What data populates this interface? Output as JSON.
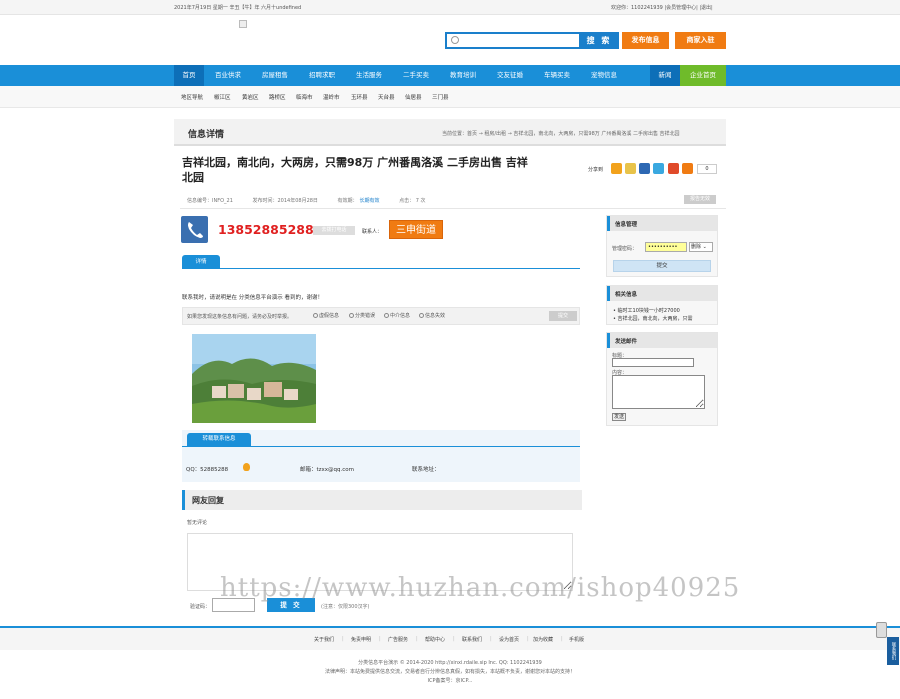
{
  "colors": {
    "accent": "#1a8fd8",
    "orange": "#f07b12",
    "phone_red": "#e02020",
    "enterprise_green": "#6fbb2a"
  },
  "topbar": {
    "date": "2021年7月19日 星期一 辛丑【牛】年 六月十undefined",
    "welcome": "欢迎你：1102241939 |会员管理中心| |退出|"
  },
  "header": {
    "search_placeholder": "",
    "search_button": "搜 索",
    "post_button": "发布信息",
    "merchant_button": "商家入驻"
  },
  "nav": {
    "items": [
      "首页",
      "百业供求",
      "房屋租售",
      "招聘求职",
      "生活服务",
      "二手买卖",
      "教育培训",
      "交友征婚",
      "车辆买卖",
      "宠物信息",
      "新闻",
      "企业首页"
    ]
  },
  "subnav": {
    "areas": [
      "地区导航",
      "椒江区",
      "黄岩区",
      "路桥区",
      "临海市",
      "温岭市",
      "玉环县",
      "天台县",
      "仙居县",
      "三门县"
    ]
  },
  "breadcrumb": {
    "title": "信息详情",
    "path": "当前位置：首页 → 租房/出租 → 吉祥北园，南北向，大两房，只需98万 广州番禺洛溪 二手房出售 吉祥北园"
  },
  "listing": {
    "title": "吉祥北园，南北向，大两房，只需98万 广州番禺洛溪 二手房出售 吉祥北园",
    "share_label": "分享到",
    "share_count": "0",
    "meta": {
      "id": "信息编号：INFO_21",
      "date": "发布时间：2014年08月28日",
      "validity": "有效期：",
      "validity_value": "长期有效",
      "hits": "点击： 7 次"
    },
    "report_button": "报告无效",
    "phone": "13852885288",
    "dial_button": "去拨打电话",
    "contact_label": "联系人：",
    "contact_name": "三申街道",
    "tab_label": "详情",
    "description": "联系我时，请说明是在 分类信息平台演示 看到的，谢谢！",
    "report_text": "如果您发现这条信息有问题，请务必及时举报。",
    "report_options": [
      "虚假信息",
      "分类错误",
      "中介信息",
      "信息失效"
    ],
    "report_submit": "提交"
  },
  "merchant": {
    "tab_label": "转载联系信息",
    "qq": "QQ：52885288",
    "email": "邮箱：tzxx@qq.com",
    "address": "联系地址："
  },
  "comments": {
    "title": "网友回复",
    "empty": "暂无评论",
    "captcha_label": "验证码：",
    "submit": "提 交",
    "note": "(注意：仅限300汉字)"
  },
  "sidebar": {
    "manage": {
      "title": "信息管理",
      "pwd_label": "管理密码：",
      "pwd_value": "••••••••••",
      "action": "删除",
      "submit": "提交"
    },
    "related": {
      "title": "相关信息",
      "items": [
        "临时工10块钱一小时27000",
        "吉祥北园，南北向，大两房，只需"
      ]
    },
    "mail": {
      "title": "发送邮件",
      "subject_label": "标题：",
      "content_label": "内容：",
      "send": "发送"
    }
  },
  "footer": {
    "links": [
      "关于我们",
      "免责申明",
      "广告服务",
      "帮助中心",
      "联系我们",
      "设为首页",
      "加为收藏",
      "手机版"
    ],
    "copyright": "分类信息平台演示 © 2014-2020 http://xinxi.rdaile.sip Inc. QQ: 1102241939",
    "disclaimer": "法律声明：本站免费提供信息交流，交易者自行分辨信息真假，如有损失，本站概不负责，谢谢您对本站的支持！",
    "icp": "ICP备案号：京ICP..."
  },
  "watermark": "https://www.huzhan.com/ishop40925",
  "float_tab": "联系我们"
}
